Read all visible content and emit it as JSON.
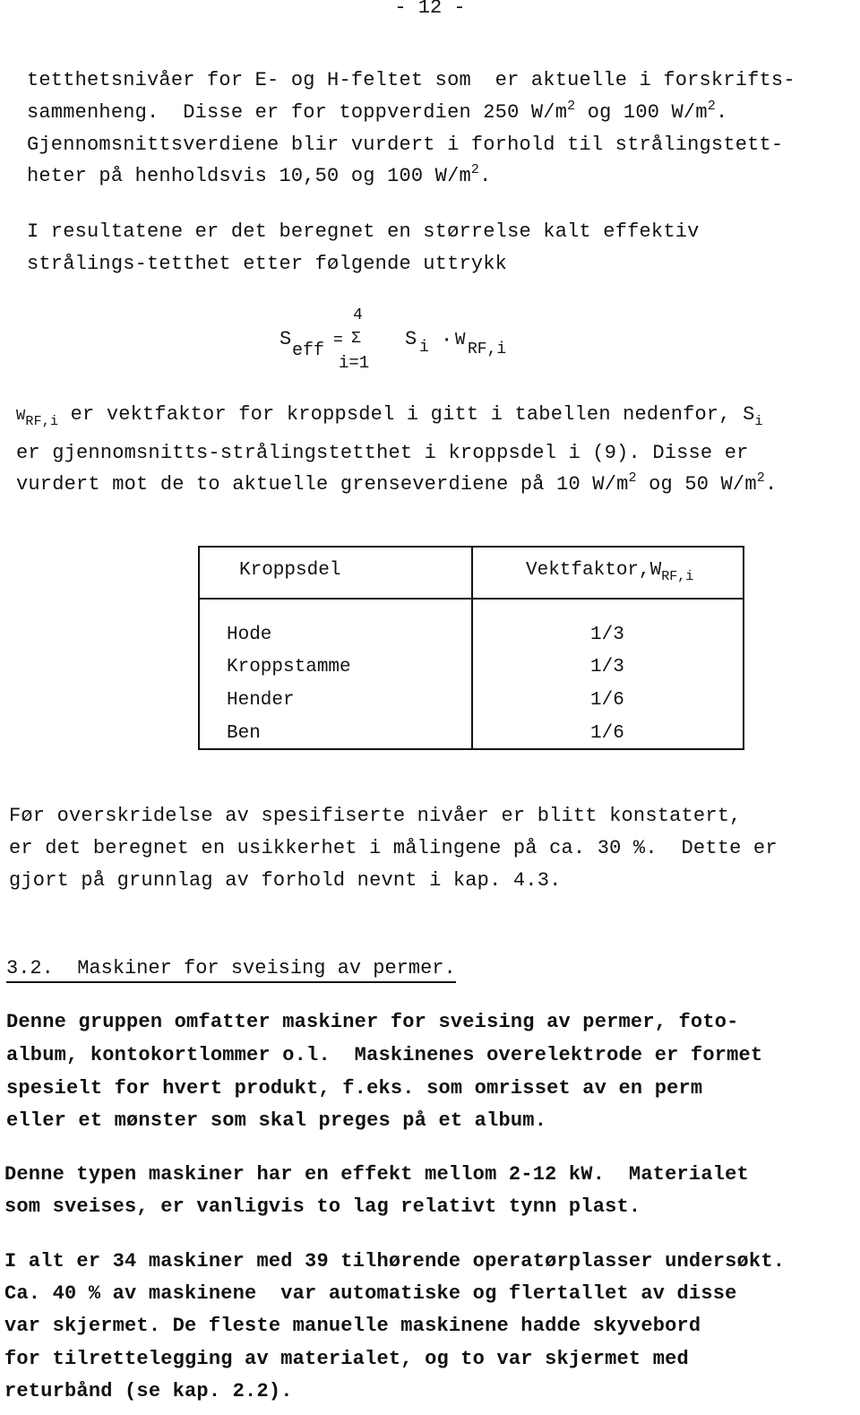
{
  "page_number": "- 12 -",
  "paragraph1": {
    "lines": [
      "tetthetsnivåer for E- og H-feltet som  er aktuelle i forskrifts-",
      "sammenheng.  Disse er for toppverdien 250 W/m",
      "Gjennomsnittsverdiene blir vurdert i forhold til strålingstett-",
      "heter på henholdsvis 10,50 og 100 W/m"
    ],
    "line2_mid": " og 100 W/m",
    "sup2": "2",
    "period": "."
  },
  "paragraph2": {
    "lines": [
      "I resultatene er det beregnet en størrelse kalt effektiv",
      "strålings-tetthet etter følgende uttrykk"
    ]
  },
  "formula": {
    "lhs": "S",
    "lhs_sub": "eff",
    "equals": "=",
    "sigma": "Σ",
    "upper": "4",
    "lower": "i=1",
    "term1": "S",
    "term1_sub": "i",
    "dot": "·",
    "term2": "W",
    "term2_sub": "RF,i"
  },
  "paragraph3": {
    "l1_w": "W",
    "l1_sub": "RF,i",
    "l1_rest": " er vektfaktor for kroppsdel i gitt i tabellen nedenfor, S",
    "l1_s_sub": "i",
    "l2": "er gjennomsnitts-strålingstetthet i kroppsdel i (9). Disse er",
    "l3a": "vurdert mot de to aktuelle grenseverdiene på 10 W/m",
    "l3b": " og 50 W/m",
    "sup2": "2",
    "period": "."
  },
  "table": {
    "headers": [
      "Kroppsdel",
      "Vektfaktor,W"
    ],
    "header2_sub": "RF,i",
    "rows": [
      {
        "body_part": "Hode",
        "weight": "1/3"
      },
      {
        "body_part": "Kroppstamme",
        "weight": "1/3"
      },
      {
        "body_part": "Hender",
        "weight": "1/6"
      },
      {
        "body_part": "Ben",
        "weight": "1/6"
      }
    ]
  },
  "paragraph4": {
    "lines": [
      "Før overskridelse av spesifiserte nivåer er blitt konstatert,",
      "er det beregnet en usikkerhet i målingene på ca. 30 %.  Dette er",
      "gjort på grunnlag av forhold nevnt i kap. 4.3."
    ]
  },
  "section_heading": "3.2.  Maskiner for sveising av permer.",
  "paragraph5": {
    "lines": [
      "Denne gruppen omfatter maskiner for sveising av permer, foto-",
      "album, kontokortlommer o.l.  Maskinenes overelektrode er formet",
      "spesielt for hvert produkt, f.eks. som omrisset av en perm",
      "eller et mønster som skal preges på et album."
    ]
  },
  "paragraph6": {
    "lines": [
      "Denne typen maskiner har en effekt mellom 2-12 kW.  Materialet",
      "som sveises, er vanligvis to lag relativt tynn plast."
    ]
  },
  "paragraph7": {
    "lines": [
      "I alt er 34 maskiner med 39 tilhørende operatørplasser undersøkt.",
      "Ca. 40 % av maskinene  var automatiske og flertallet av disse",
      "var skjermet. De fleste manuelle maskinene hadde skyvebord",
      "for tilrettelegging av materialet, og to var skjermet med",
      "returbånd (se kap. 2.2)."
    ]
  }
}
